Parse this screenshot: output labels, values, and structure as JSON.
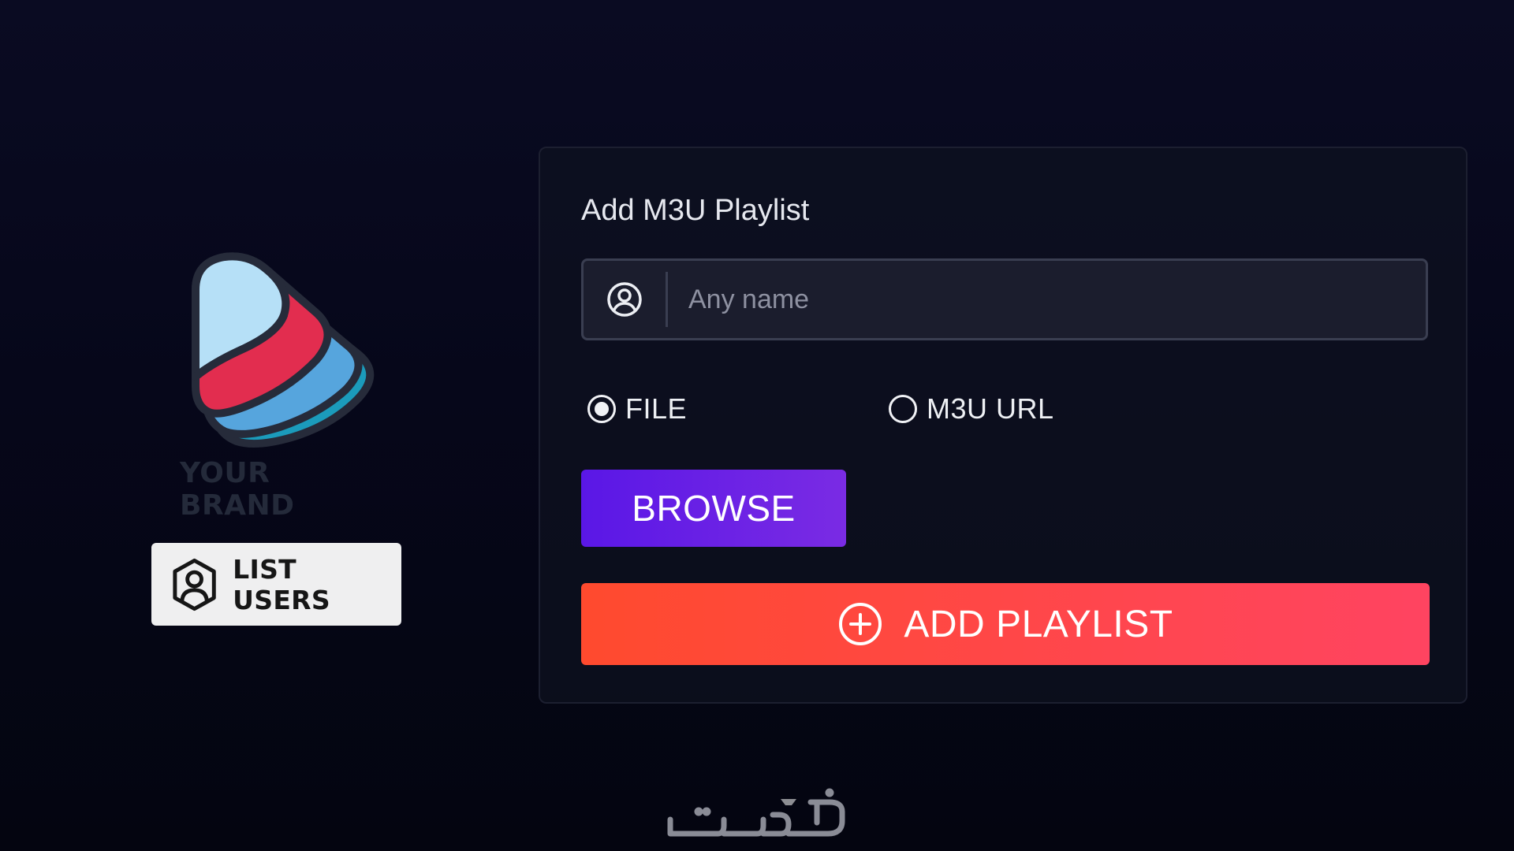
{
  "brand": {
    "logo_icon": "brand-play-logo-icon",
    "wordmark": "YOUR BRAND",
    "colors": {
      "light_blue": "#b6e0f7",
      "red": "#e22d4f",
      "blue": "#56a5dd",
      "teal": "#1b9bbb",
      "outline": "#262b3a"
    }
  },
  "sidebar": {
    "list_users_label": "LIST USERS",
    "list_users_icon": "user-hexagon-icon"
  },
  "form": {
    "title": "Add M3U Playlist",
    "name_field": {
      "placeholder": "Any name",
      "value": "",
      "icon": "user-circle-icon"
    },
    "source_options": [
      {
        "label": "FILE",
        "selected": true
      },
      {
        "label": "M3U URL",
        "selected": false
      }
    ],
    "browse_label": "BROWSE",
    "add_playlist_label": "ADD PLAYLIST",
    "add_playlist_icon": "plus-circle-icon"
  },
  "watermark": {
    "text": "خمسات"
  },
  "colors": {
    "background": "#06071a",
    "browse_gradient": [
      "#5a17e6",
      "#7a2be4"
    ],
    "add_gradient": [
      "#ff4a2e",
      "#ff4461"
    ],
    "list_users_bg": "#efeff0"
  }
}
